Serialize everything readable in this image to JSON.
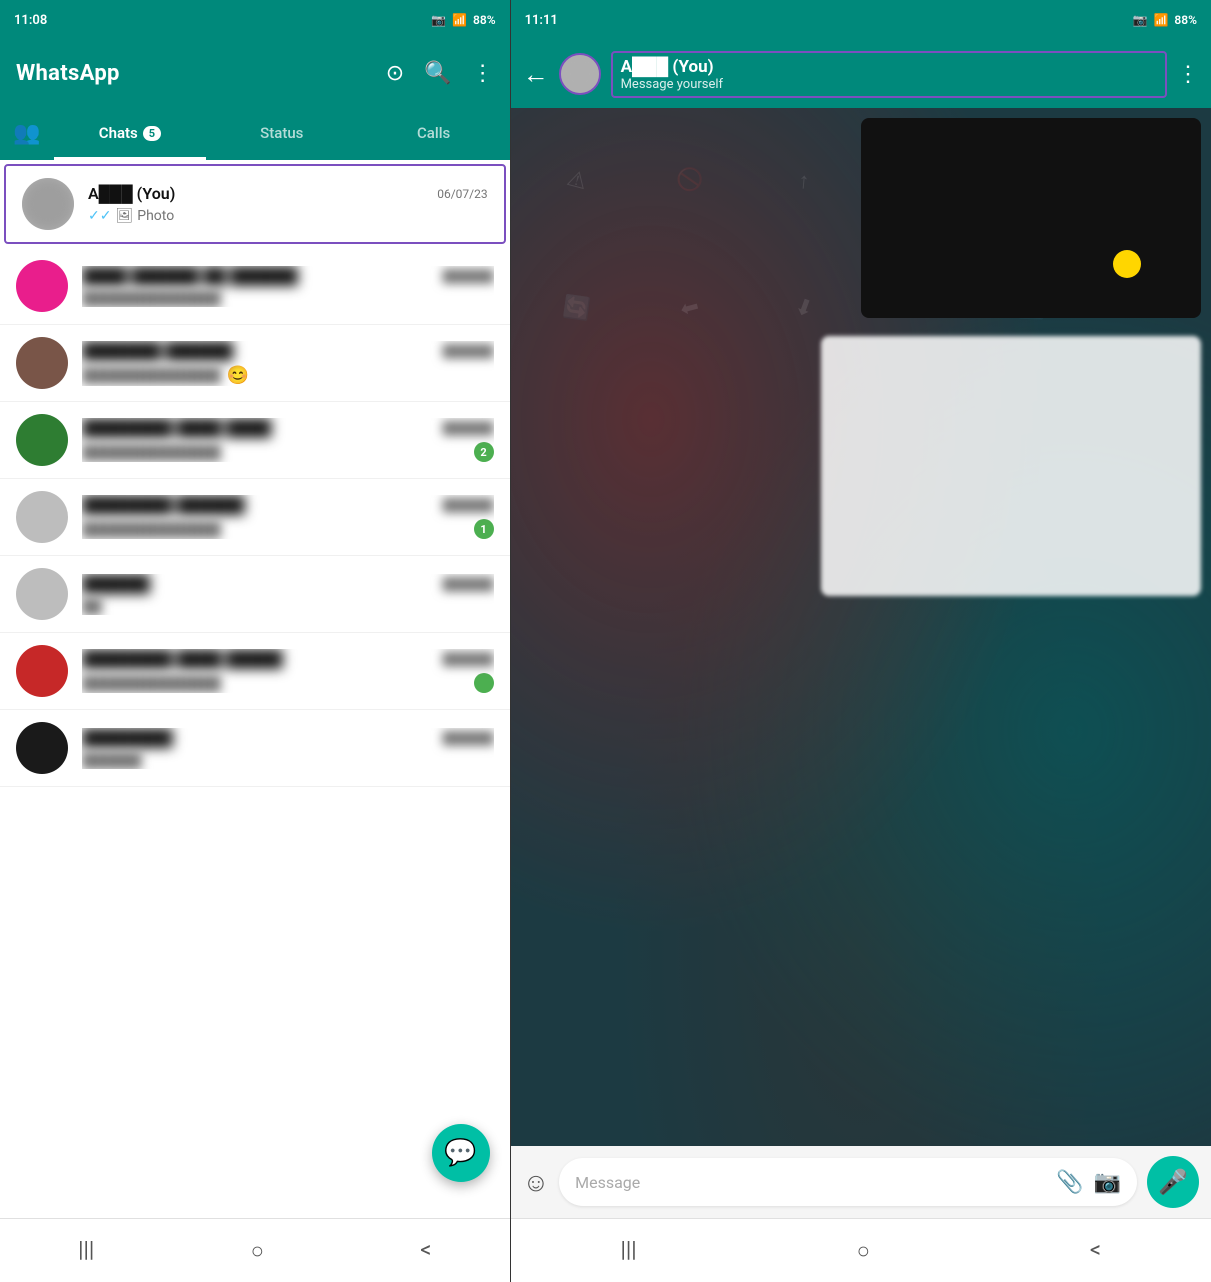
{
  "left_phone": {
    "status_bar": {
      "time": "11:08",
      "battery": "88%"
    },
    "toolbar": {
      "title": "WhatsApp"
    },
    "tabs": {
      "chats_label": "Chats",
      "chats_badge": "5",
      "status_label": "Status",
      "calls_label": "Calls"
    },
    "highlighted_chat": {
      "name": "A███ (You)",
      "time": "06/07/23",
      "preview_icon": "✓✓",
      "preview_text": "🖼 Photo"
    },
    "chat_list": [
      {
        "id": 1,
        "name": "████ ██████ ██ ██████",
        "time": "██████",
        "preview": "██████████████",
        "avatar_color": "#E91E8C"
      },
      {
        "id": 2,
        "name": "███████ ██████",
        "time": "██████",
        "preview": "██████████████",
        "avatar_color": "#795548"
      },
      {
        "id": 3,
        "name": "████████ ████ ████",
        "time": "██████",
        "preview": "██████████████",
        "avatar_color": "#2E7D32"
      },
      {
        "id": 4,
        "name": "████████ ██████",
        "time": "██████",
        "preview": "██████████████",
        "avatar_color": "#bdbdbd"
      },
      {
        "id": 5,
        "name": "██████",
        "time": "██████",
        "preview": "██",
        "avatar_color": "#bdbdbd"
      },
      {
        "id": 6,
        "name": "████████ ████ █████",
        "time": "██████",
        "preview": "██████████████",
        "avatar_color": "#c62828"
      }
    ],
    "fab_icon": "💬",
    "nav": [
      "|||",
      "○",
      "<"
    ]
  },
  "right_phone": {
    "status_bar": {
      "time": "11:11",
      "battery": "88%"
    },
    "chat_header": {
      "contact_name": "A███ (You)",
      "status": "Message yourself"
    },
    "message_placeholder": "Message",
    "nav": [
      "|||",
      "○",
      "<"
    ]
  }
}
